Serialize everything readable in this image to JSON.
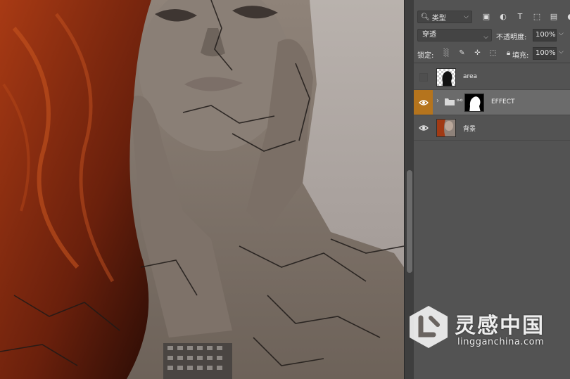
{
  "layers_panel": {
    "filter": {
      "kind_label": "类型"
    },
    "blend_mode": "穿透",
    "opacity": {
      "label": "不透明度:",
      "value": "100%"
    },
    "lock": {
      "label": "锁定:"
    },
    "fill": {
      "label": "填充:",
      "value": "100%"
    },
    "layers": [
      {
        "name": "area",
        "visible": false,
        "selected": false
      },
      {
        "name": "EFFECT",
        "visible": true,
        "selected": true,
        "type": "group"
      },
      {
        "name": "背景",
        "visible": true,
        "selected": false
      }
    ]
  },
  "watermark": {
    "text_cn": "灵感中国",
    "text_en": "lingganchina.com"
  },
  "colors": {
    "panel_bg": "#535353",
    "selected_layer": "#6b6b6b",
    "eye_active": "#b5741d",
    "hair": "#7a2a12"
  }
}
